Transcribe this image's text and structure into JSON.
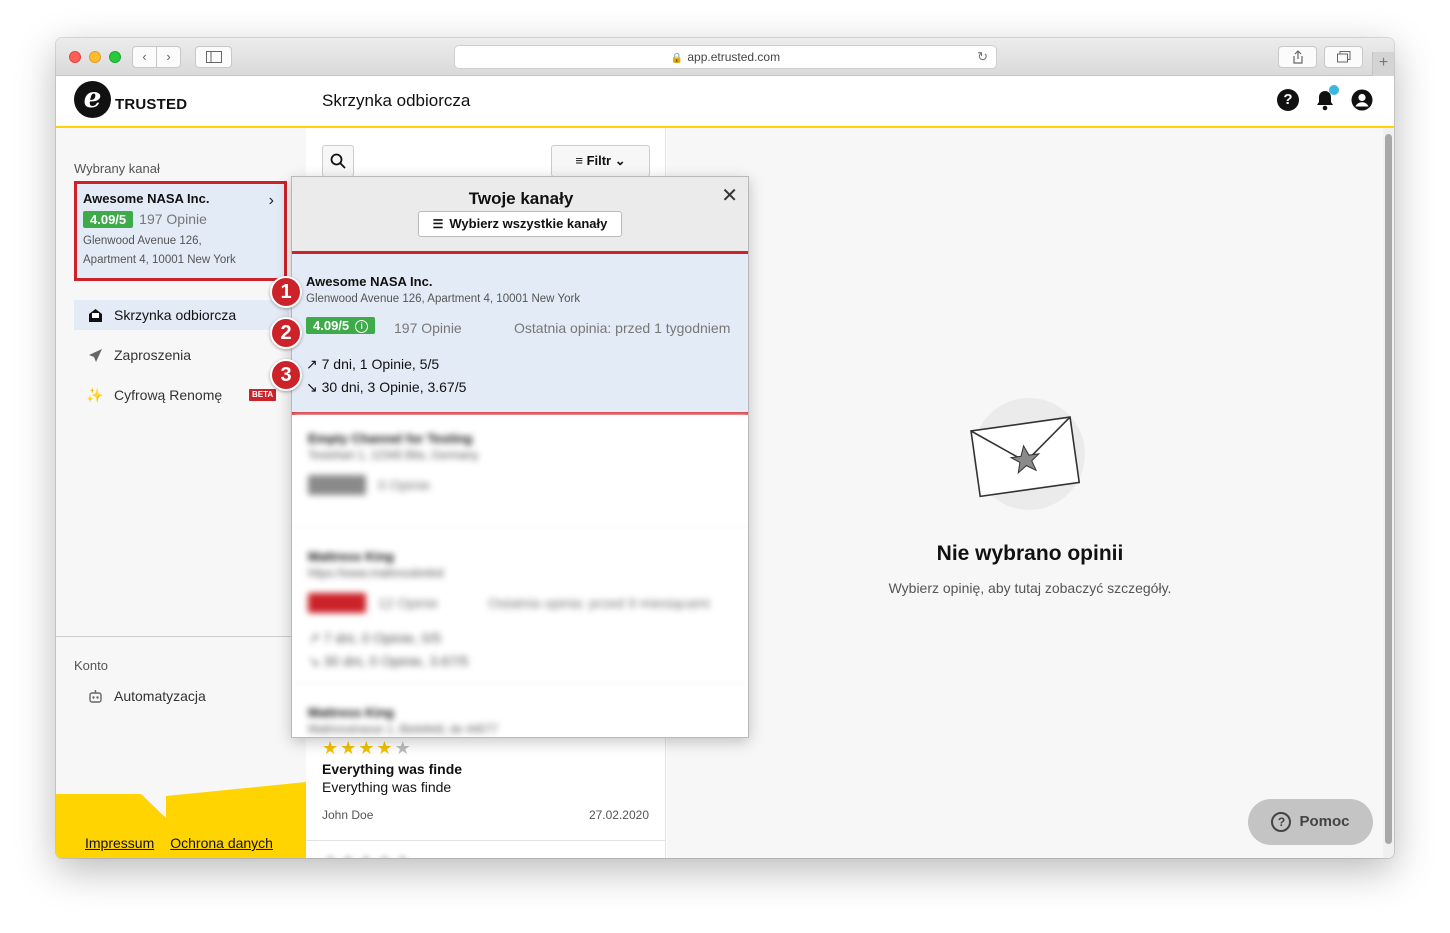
{
  "browser": {
    "url": "app.etrusted.com"
  },
  "header": {
    "logo_text": "TRUSTED",
    "page_title": "Skrzynka odbiorcza",
    "help_icon": "?"
  },
  "sidebar": {
    "selected_channel_label": "Wybrany kanał",
    "channel": {
      "name": "Awesome NASA Inc.",
      "rating": "4.09/5",
      "count": "197 Opinie",
      "address_line1": "Glenwood Avenue 126,",
      "address_line2": "Apartment 4, 10001 New York"
    },
    "nav": [
      {
        "label": "Skrzynka odbiorcza",
        "icon": "inbox-icon"
      },
      {
        "label": "Zaproszenia",
        "icon": "send-icon"
      },
      {
        "label": "Cyfrową Renomę",
        "icon": "sparkle-icon",
        "badge": "BETA"
      }
    ],
    "account_label": "Konto",
    "account_nav": [
      {
        "label": "Automatyzacja",
        "icon": "robot-icon"
      }
    ],
    "footer": {
      "impressum": "Impressum",
      "privacy": "Ochrona danych"
    }
  },
  "toolbar": {
    "filter_label": "Filtr"
  },
  "review": {
    "stars": 4,
    "title": "Everything was finde",
    "body": "Everything was finde",
    "author": "John Doe",
    "date": "27.02.2020"
  },
  "channels_panel": {
    "title": "Twoje kanały",
    "select_all": "Wybierz wszystkie kanały",
    "active": {
      "name": "Awesome NASA Inc.",
      "address": "Glenwood Avenue 126, Apartment 4, 10001 New York",
      "rating": "4.09/5",
      "count": "197 Opinie",
      "last_review": "Ostatnia opinia: przed 1 tygodniem",
      "trend_7": "7 dni, 1 Opinie, 5/5",
      "trend_30": "30 dni, 3 Opinie, 3.67/5"
    },
    "others": [
      {
        "name": "Empty Channel for Testing",
        "address": "Testshart 1, 12345 Bits, Germany",
        "count": "0 Opinie"
      },
      {
        "name": "Mattress King",
        "address": "https://www.mattresskinkid",
        "count": "12 Opinie",
        "last_review": "Ostatnia opinia: przed 9 miesiącami",
        "trend_7": "7 dni, 0 Opinie, 0/5",
        "trend_30": "30 dni, 0 Opinie, 3.67/5"
      },
      {
        "name": "Mattress King",
        "address": "Mattresstrasse 1, Bielefeld, de 44577"
      }
    ]
  },
  "markers": [
    "1",
    "2",
    "3"
  ],
  "empty_state": {
    "title": "Nie wybrano opinii",
    "subtitle": "Wybierz opinię, aby tutaj zobaczyć szczegóły."
  },
  "help_button": {
    "label": "Pomoc"
  },
  "colors": {
    "brand_yellow": "#ffd400",
    "rating_green": "#3faa4a",
    "highlight_red": "#cc2229",
    "selection_blue": "#e3ebf6"
  }
}
